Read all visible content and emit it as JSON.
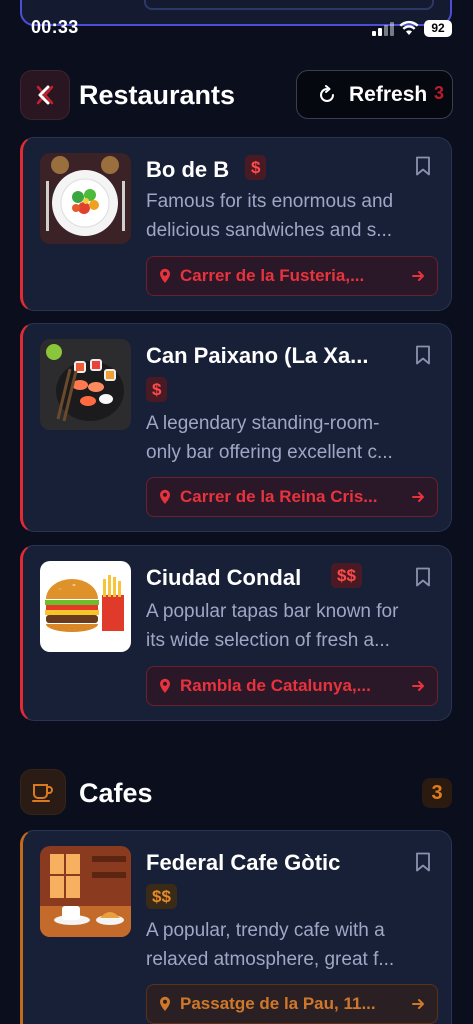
{
  "status_bar": {
    "time": "00:33",
    "battery": "92"
  },
  "colors": {
    "restaurant_accent": "#e02b37",
    "cafe_accent": "#c26a1d",
    "background": "#0b0f1d",
    "card": "#182038"
  },
  "restaurants": {
    "title": "Restaurants",
    "refresh_label": "Refresh",
    "count": "3",
    "icon": "utensils-crossed-icon",
    "items": [
      {
        "name": "Bo de B",
        "price": "$",
        "desc_line1": "Famous for its enormous and",
        "desc_line2": "delicious sandwiches and s...",
        "location": "Carrer de la Fusteria,...",
        "thumb": "salad-plate-icon"
      },
      {
        "name": "Can Paixano (La Xa...",
        "price": "$",
        "desc_line1": "A legendary standing-room-",
        "desc_line2": "only bar offering excellent c...",
        "location": "Carrer de la Reina Cris...",
        "thumb": "sushi-platter-icon"
      },
      {
        "name": "Ciudad Condal",
        "price": "$$",
        "desc_line1": "A popular tapas bar known for",
        "desc_line2": "its wide selection of fresh a...",
        "location": "Rambla de Catalunya,...",
        "thumb": "burger-fries-icon"
      }
    ]
  },
  "cafes": {
    "title": "Cafes",
    "count": "3",
    "icon": "coffee-cup-icon",
    "items": [
      {
        "name": "Federal Cafe Gòtic",
        "price": "$$",
        "desc_line1": "A popular, trendy cafe with a",
        "desc_line2": "relaxed atmosphere, great f...",
        "location": "Passatge de la Pau, 11...",
        "thumb": "cafe-interior-icon"
      }
    ]
  }
}
